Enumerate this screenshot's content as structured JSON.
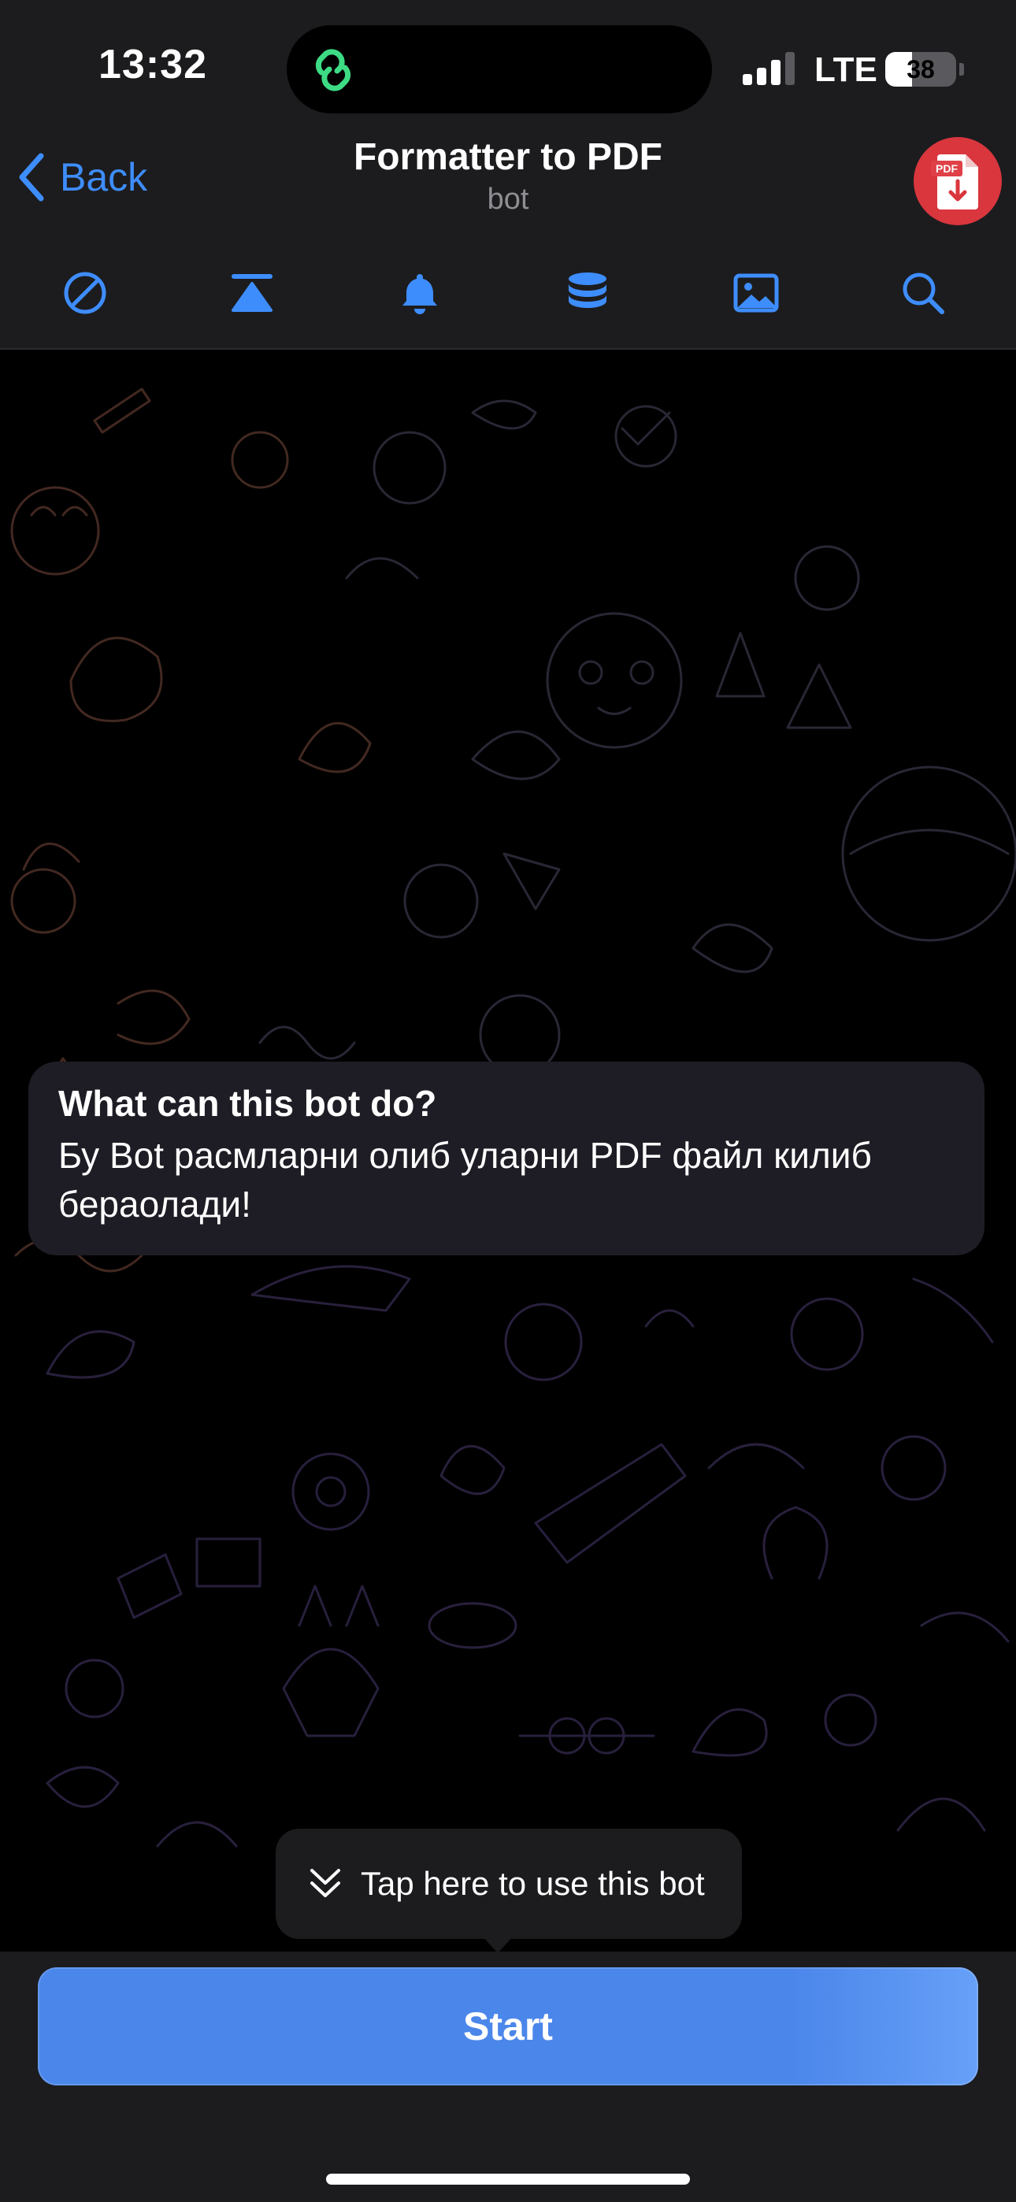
{
  "status_bar": {
    "time": "13:32",
    "network": "LTE",
    "battery": "38",
    "battery_level": 0.38
  },
  "header": {
    "back_label": "Back",
    "title": "Formatter to PDF",
    "subtitle": "bot",
    "avatar_icon": "pdf-file-icon",
    "avatar_label": "PDF"
  },
  "toolbar": {
    "icons": [
      "block-icon",
      "pin-top-icon",
      "bell-icon",
      "database-icon",
      "image-icon",
      "search-icon"
    ]
  },
  "chat": {
    "bubble_title": "What can this bot do?",
    "bubble_text": "Бу Bot расмларни олиб уларни PDF файл килиб бераолади!",
    "tooltip_text": "Tap here to use this bot"
  },
  "bottom": {
    "start_label": "Start"
  },
  "colors": {
    "accent": "#3e8dfd",
    "button": "#4b86ea",
    "panel": "#1c1c1e",
    "bubble": "#1e1c24",
    "avatar": "#d9363e"
  }
}
